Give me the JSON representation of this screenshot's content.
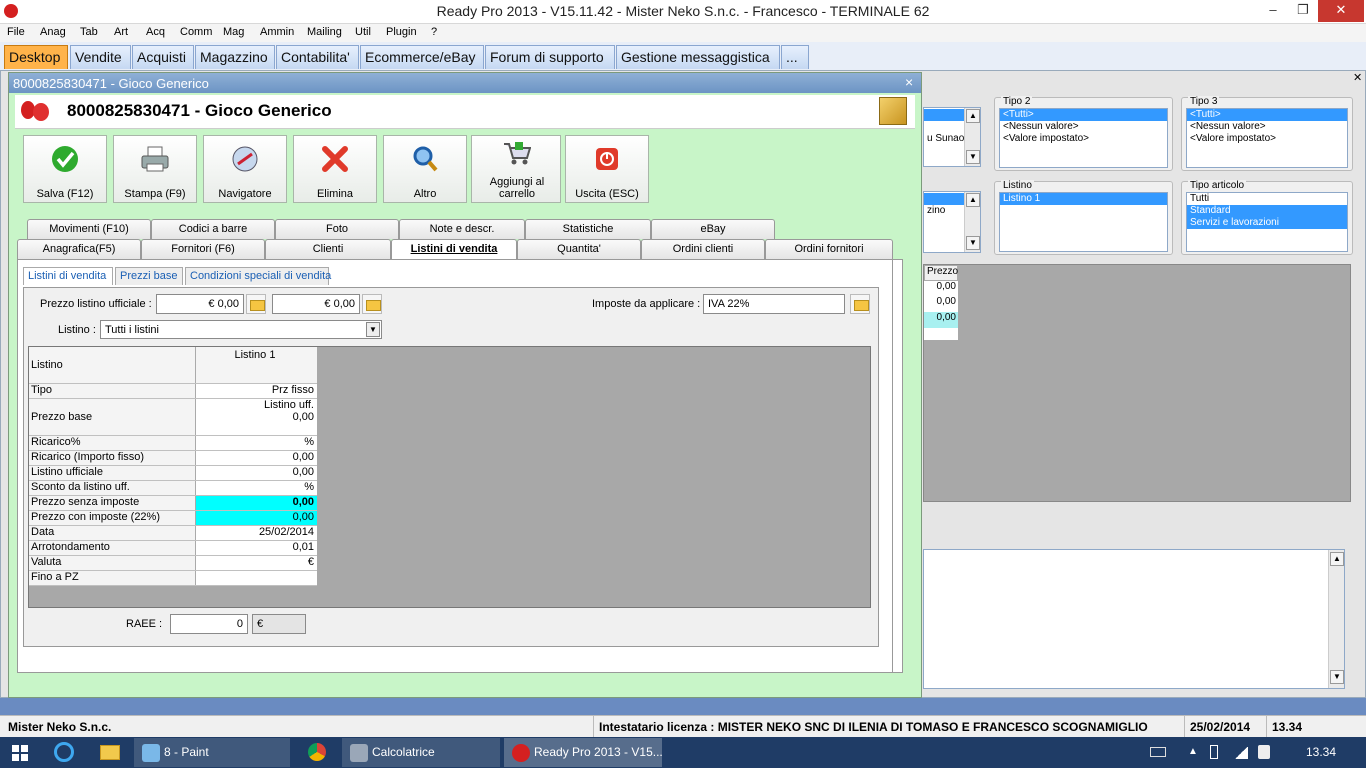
{
  "window": {
    "title": "Ready Pro 2013 - V15.11.42 - Mister Neko S.n.c. - Francesco - TERMINALE 62",
    "min": "‒",
    "max": "❐",
    "close": "✕"
  },
  "menu": [
    "File",
    "Anag",
    "Tab",
    "Art",
    "Acq",
    "Comm",
    "Mag",
    "Ammin",
    "Mailing",
    "Util",
    "Plugin",
    "?"
  ],
  "toptabs": [
    "Desktop",
    "Vendite",
    "Acquisti",
    "Magazzino",
    "Contabilita'",
    "Ecommerce/eBay",
    "Forum di supporto",
    "Gestione messaggistica",
    "..."
  ],
  "bg": {
    "tipo2": {
      "label": "Tipo 2",
      "items": [
        "<Tutti>",
        "<Nessun valore>",
        "<Valore impostato>"
      ]
    },
    "tipo3": {
      "label": "Tipo 3",
      "items": [
        "<Tutti>",
        "<Nessun valore>",
        "<Valore impostato>"
      ]
    },
    "listino": {
      "label": "Listino",
      "items": [
        "Listino 1"
      ]
    },
    "tipoart": {
      "label": "Tipo articolo",
      "items": [
        "Tutti",
        "Standard",
        "Servizi e lavorazioni"
      ]
    },
    "frag1": "u Sunao",
    "frag2": "zino",
    "prezzo_header": "Prezzo",
    "prezzi": [
      "0,00",
      "0,00",
      "0,00"
    ]
  },
  "dialog": {
    "title": "8000825830471 - Gioco Generico",
    "header": "8000825830471 - Gioco Generico",
    "close": "×",
    "toolbar": [
      "Salva (F12)",
      "Stampa (F9)",
      "Navigatore",
      "Elimina",
      "Altro",
      "Aggiungi al carrello",
      "Uscita (ESC)"
    ],
    "tabs_row1": [
      "Movimenti (F10)",
      "Codici a barre",
      "Foto",
      "Note e descr.",
      "Statistiche",
      "eBay"
    ],
    "tabs_row2": [
      "Anagrafica(F5)",
      "Fornitori (F6)",
      "Clienti",
      "Listini di vendita",
      "Quantita'",
      "Ordini clienti",
      "Ordini fornitori"
    ],
    "subtabs": [
      "Listini di vendita",
      "Prezzi base",
      "Condizioni speciali di vendita"
    ],
    "prezzo_label": "Prezzo listino ufficiale :",
    "prezzo1": "€ 0,00",
    "prezzo2": "€ 0,00",
    "imposte_label": "Imposte da applicare :",
    "imposte": "IVA 22%",
    "listino_label": "Listino :",
    "listino_value": "Tutti i listini",
    "grid": {
      "col_header": "Listino 1",
      "row_header": "Listino",
      "rows": [
        {
          "label": "Tipo",
          "value": "Prz fisso"
        },
        {
          "label": "Prezzo base",
          "value": "Listino uff.",
          "value2": "0,00"
        },
        {
          "label": "Ricarico%",
          "value": "%"
        },
        {
          "label": "Ricarico (Importo fisso)",
          "value": "0,00"
        },
        {
          "label": "Listino ufficiale",
          "value": "0,00"
        },
        {
          "label": "Sconto da listino uff.",
          "value": "%"
        },
        {
          "label": "Prezzo senza imposte",
          "value": "0,00"
        },
        {
          "label": "Prezzo con imposte (22%)",
          "value": "0,00"
        },
        {
          "label": "Data",
          "value": "25/02/2014"
        },
        {
          "label": "Arrotondamento",
          "value": "0,01"
        },
        {
          "label": "Valuta",
          "value": "€"
        },
        {
          "label": "Fino a PZ",
          "value": ""
        }
      ]
    },
    "raee_label": "RAEE :",
    "raee_value": "0",
    "raee_unit": "€"
  },
  "status": {
    "company": "Mister Neko S.n.c.",
    "license": "Intestatario licenza : MISTER NEKO SNC DI ILENIA DI TOMASO E FRANCESCO SCOGNAMIGLIO",
    "date": "25/02/2014",
    "time": "13.34"
  },
  "taskbar": {
    "paint": "8 - Paint",
    "calc": "Calcolatrice",
    "readypro": "Ready Pro 2013 - V15...",
    "clock": "13.34"
  }
}
